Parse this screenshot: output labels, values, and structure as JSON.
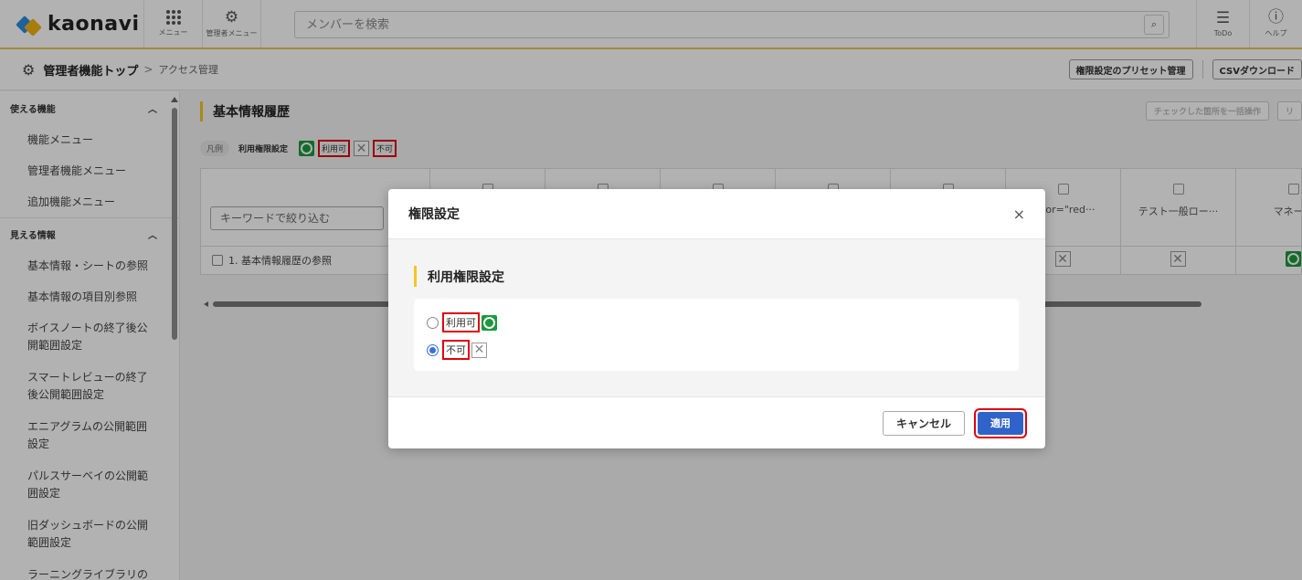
{
  "header": {
    "logo_text": "kaonavi",
    "menu_label": "メニュー",
    "admin_menu_label": "管理者メニュー",
    "search_placeholder": "メンバーを検索",
    "search_icon": "search-icon",
    "todo_label": "ToDo",
    "help_label": "ヘルプ",
    "accent_color": "#e8c35a"
  },
  "breadcrumb": {
    "top": "管理者機能トップ",
    "separator": ">",
    "current": "アクセス管理"
  },
  "toolbar": {
    "preset_button": "権限設定のプリセット管理",
    "csv_button": "CSVダウンロード"
  },
  "sidebar": {
    "sections": [
      {
        "title": "使える機能",
        "items": [
          "機能メニュー",
          "管理者機能メニュー",
          "追加機能メニュー"
        ]
      },
      {
        "title": "見える情報",
        "items": [
          "基本情報・シートの参照",
          "基本情報の項目別参照",
          "ボイスノートの終了後公開範囲設定",
          "スマートレビューの終了後公開範囲設定",
          "エニアグラムの公開範囲設定",
          "パルスサーベイの公開範囲設定",
          "旧ダッシュボードの公開範囲設定",
          "ラーニングライブラリの"
        ]
      }
    ]
  },
  "main": {
    "section_title": "基本情報履歴",
    "bulk_button": "チェックした箇所を一括操作",
    "extra_button": "リ",
    "legend": {
      "pill": "凡例",
      "label": "利用権限設定",
      "ok_text": "利用可",
      "ng_text": "不可"
    },
    "table": {
      "filter_placeholder": "キーワードで絞り込む",
      "columns": [
        "",
        "",
        "",
        "",
        "",
        "color=\"red···",
        "テスト一般ロー···",
        "マネージ"
      ],
      "rows": [
        {
          "label": "1. 基本情報履歴の参照",
          "cells": [
            "ng",
            "ng",
            "ok"
          ]
        }
      ]
    }
  },
  "dialog": {
    "title": "権限設定",
    "close_symbol": "×",
    "subtitle": "利用権限設定",
    "options": [
      {
        "label": "利用可",
        "icon": "ok",
        "selected": false
      },
      {
        "label": "不可",
        "icon": "ng",
        "selected": true
      }
    ],
    "cancel_label": "キャンセル",
    "apply_label": "適用",
    "apply_color": "#2f63c9",
    "highlight_color": "#e0000e"
  }
}
